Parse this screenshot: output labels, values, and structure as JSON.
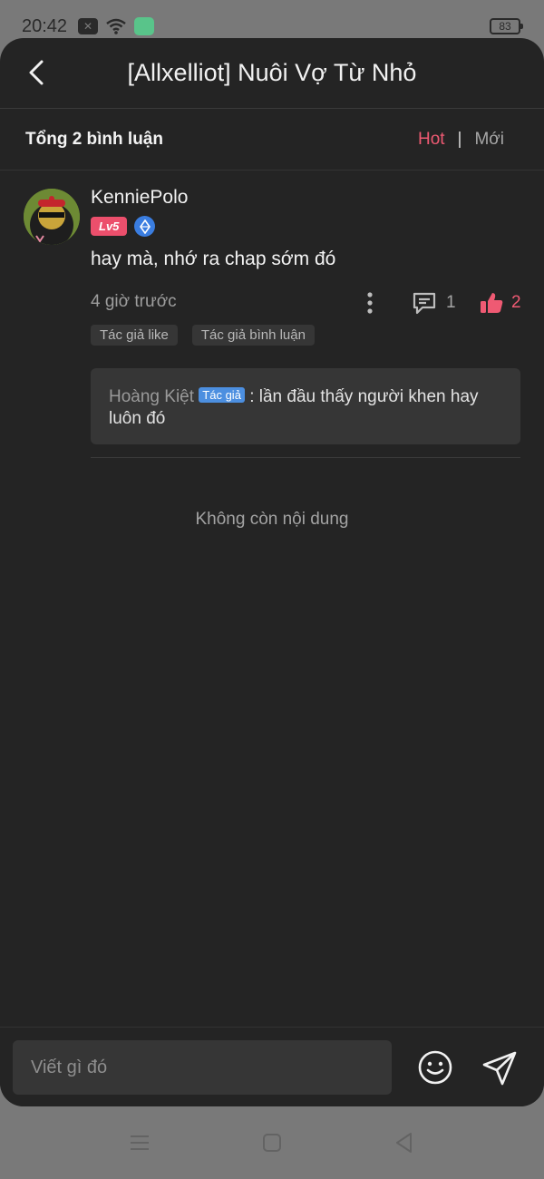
{
  "status": {
    "time": "20:42",
    "battery": "83"
  },
  "header": {
    "title": "[Allxelliot] Nuôi Vợ Từ Nhỏ"
  },
  "comments_header": {
    "count_label": "Tổng 2 bình luận",
    "sort_hot": "Hot",
    "separator": "|",
    "sort_new": "Mới"
  },
  "comment": {
    "user": "KenniePolo",
    "level": "Lv5",
    "text": "hay mà, nhớ ra chap sớm đó",
    "time": "4 giờ trước",
    "reply_count": "1",
    "like_count": "2",
    "tags": [
      "Tác giả like",
      "Tác giả bình luận"
    ],
    "reply": {
      "author": "Hoàng Kiệt",
      "author_tag": "Tác giả",
      "text": " : lần đầu thấy người khen hay luôn đó"
    }
  },
  "end_text": "Không còn nội dung",
  "composer": {
    "placeholder": "Viết gì đó"
  },
  "colors": {
    "accent": "#ef5a73",
    "background": "#242424",
    "author_badge": "#4c8fe0"
  },
  "icons": [
    "back-icon",
    "comment-icon",
    "thumbs-up-icon",
    "more-vertical-icon",
    "emoji-icon",
    "send-icon"
  ]
}
